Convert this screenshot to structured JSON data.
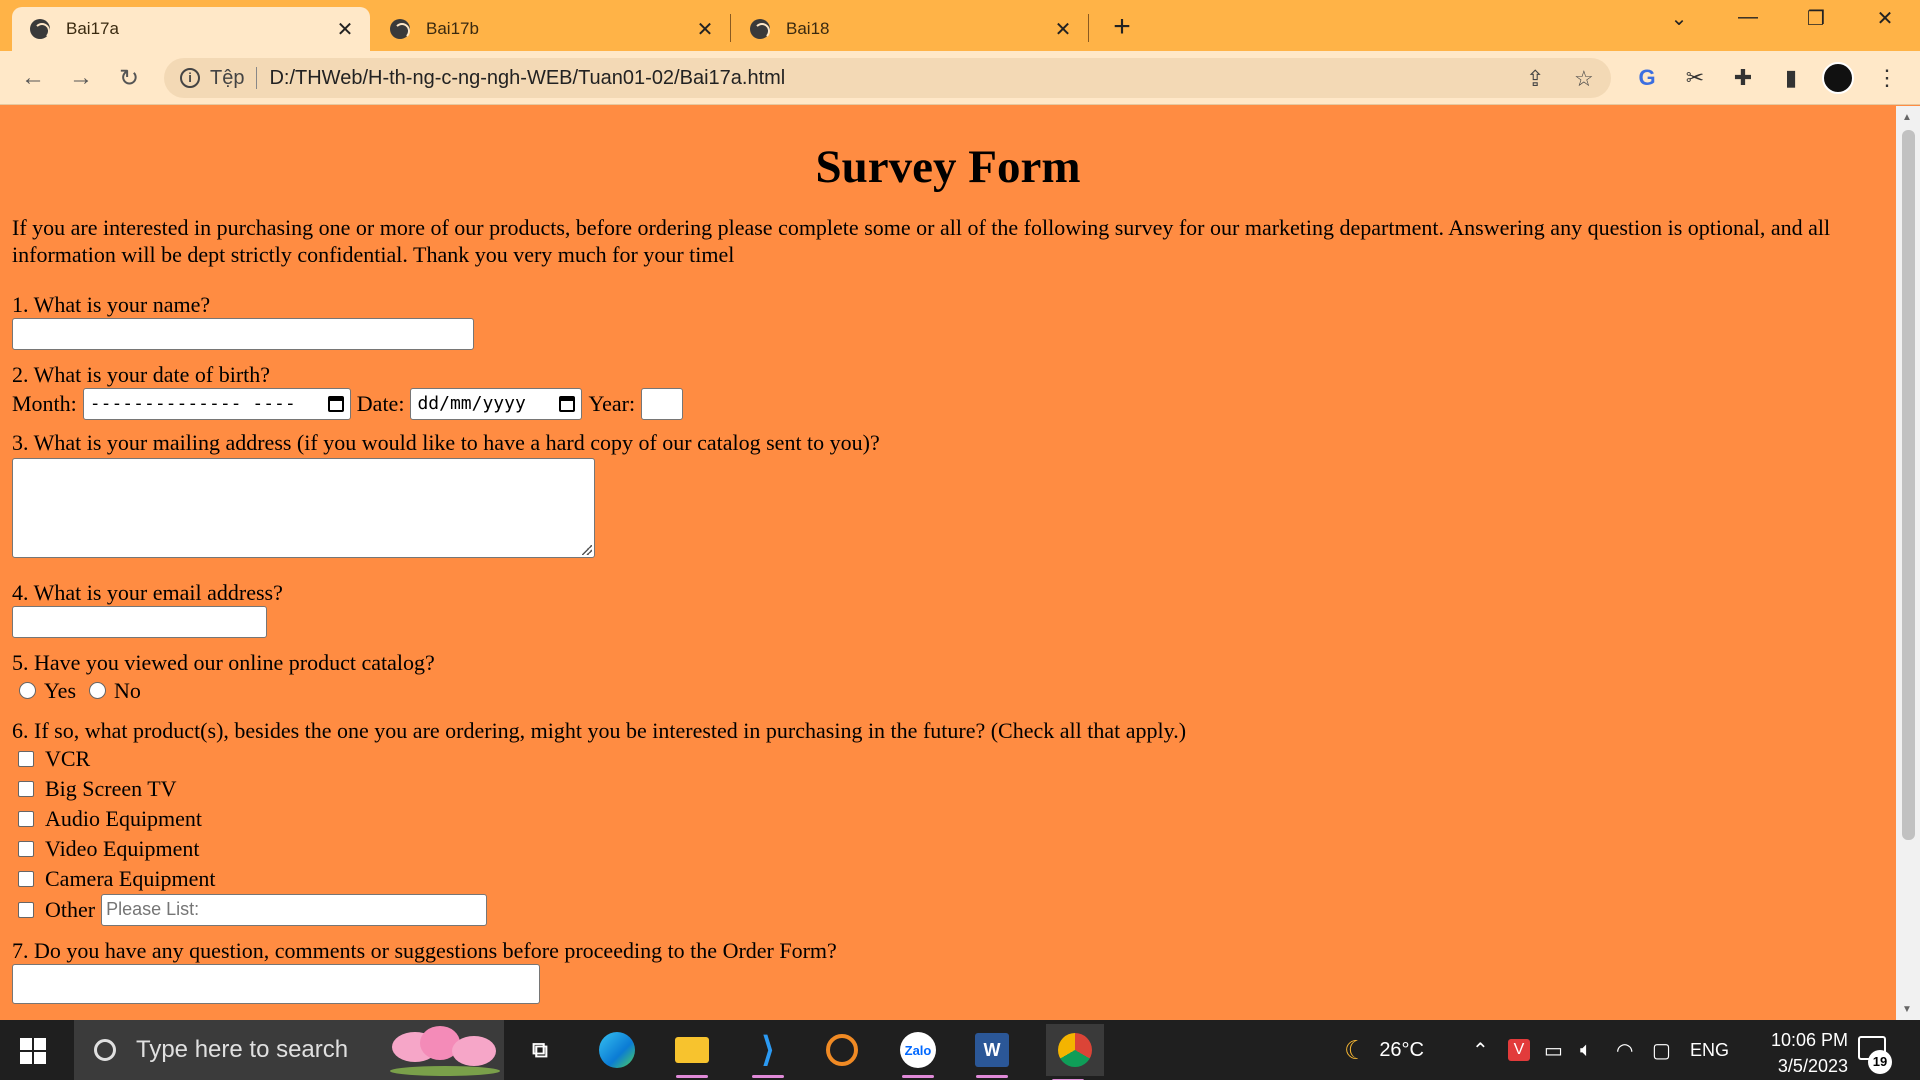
{
  "browser": {
    "tabs": [
      {
        "title": "Bai17a",
        "active": true
      },
      {
        "title": "Bai17b",
        "active": false
      },
      {
        "title": "Bai18",
        "active": false
      }
    ],
    "address": {
      "scheme_label": "Tệp",
      "url": "D:/THWeb/H-th-ng-c-ng-ngh-WEB/Tuan01-02/Bai17a.html"
    }
  },
  "page": {
    "title": "Survey Form",
    "intro": "If you are interested in purchasing one or more of our products, before ordering please complete some or all of the following survey for our marketing department. Answering any question is optional, and all information will be dept strictly confidential. Thank you very much for your timel",
    "q1": "1. What is your name?",
    "q2": "2. What is your date of birth?",
    "q2_month_label": "Month:",
    "q2_month_value": "-------------- ----",
    "q2_date_label": "Date:",
    "q2_date_value": "dd/mm/yyyy",
    "q2_year_label": "Year:",
    "q3": "3. What is your mailing address (if you would like to have a hard copy of our catalog sent to you)?",
    "q4": "4. What is your email address?",
    "q5": "5. Have you viewed our online product catalog?",
    "q5_options": [
      "Yes",
      "No"
    ],
    "q6": "6. If so, what product(s), besides the one you are ordering, might you be interested in purchasing in the future? (Check all that apply.)",
    "q6_options": [
      "VCR",
      "Big Screen TV",
      "Audio Equipment",
      "Video Equipment",
      "Camera Equipment",
      "Other"
    ],
    "q6_other_placeholder": "Please List:",
    "q7": "7. Do you have any question, comments or suggestions before proceeding to the Order Form?"
  },
  "taskbar": {
    "search_placeholder": "Type here to search",
    "weather": "26°C",
    "language": "ENG",
    "time": "10:06 PM",
    "date": "3/5/2023",
    "notification_count": "19"
  }
}
